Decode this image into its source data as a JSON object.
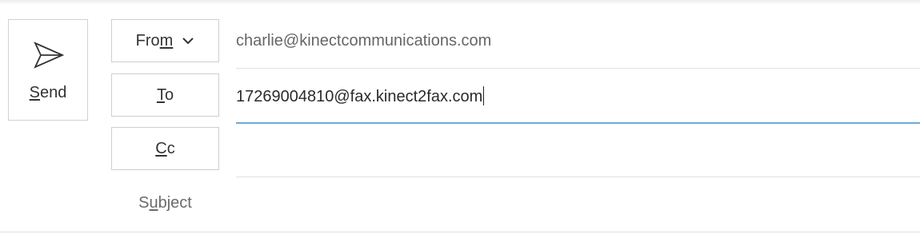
{
  "send": {
    "label_underlined": "S",
    "label_rest": "end",
    "icon": "send-icon"
  },
  "from": {
    "label_pre": "Fro",
    "label_underlined": "m",
    "icon": "chevron-down-icon",
    "value": "charlie@kinectcommunications.com"
  },
  "to": {
    "label_underlined": "T",
    "label_rest": "o",
    "value": "17269004810@fax.kinect2fax.com"
  },
  "cc": {
    "label_underlined": "C",
    "label_rest": "c",
    "value": ""
  },
  "subject": {
    "label_pre": "S",
    "label_underlined": "u",
    "label_rest": "bject",
    "value": ""
  },
  "colors": {
    "active_underline": "#6ea8d6",
    "border": "#d2d2d2",
    "text": "#333333",
    "muted_text": "#666666"
  }
}
